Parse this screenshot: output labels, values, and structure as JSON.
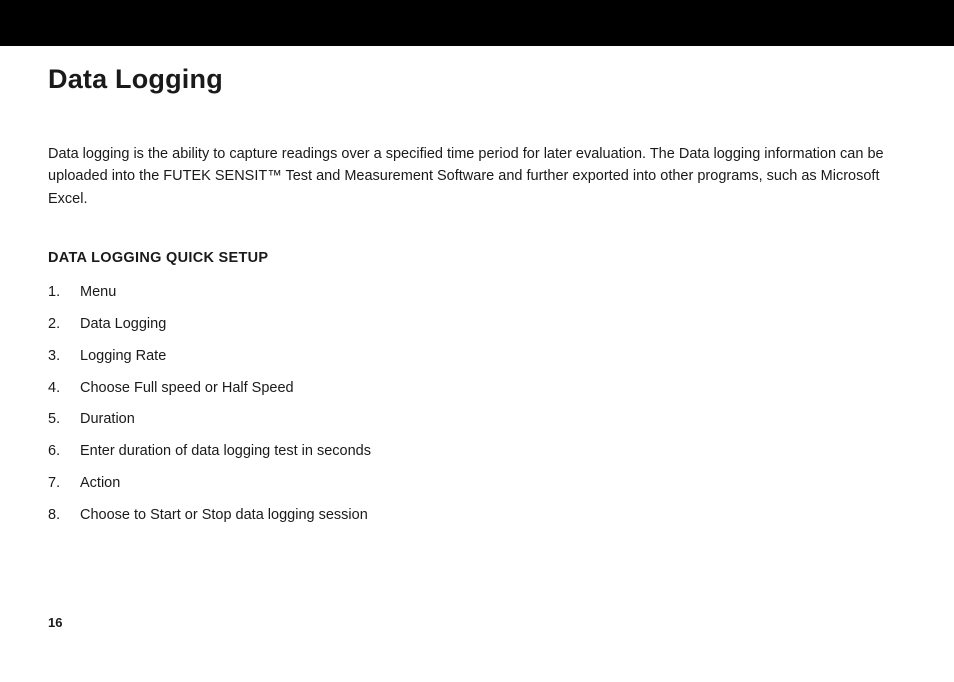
{
  "page": {
    "title": "Data Logging",
    "intro": "Data logging is the ability to capture readings over a specified time period for later evaluation. The Data logging information can be uploaded into the FUTEK SENSIT™ Test and Measurement Software and further exported into other programs, such as Microsoft Excel.",
    "section_heading": "DATA LOGGING QUICK SETUP",
    "steps": [
      "Menu",
      "Data Logging",
      "Logging Rate",
      "Choose Full speed or Half Speed",
      "Duration",
      "Enter duration of data logging test in seconds",
      "Action",
      "Choose to Start or Stop data logging session"
    ],
    "page_number": "16"
  }
}
